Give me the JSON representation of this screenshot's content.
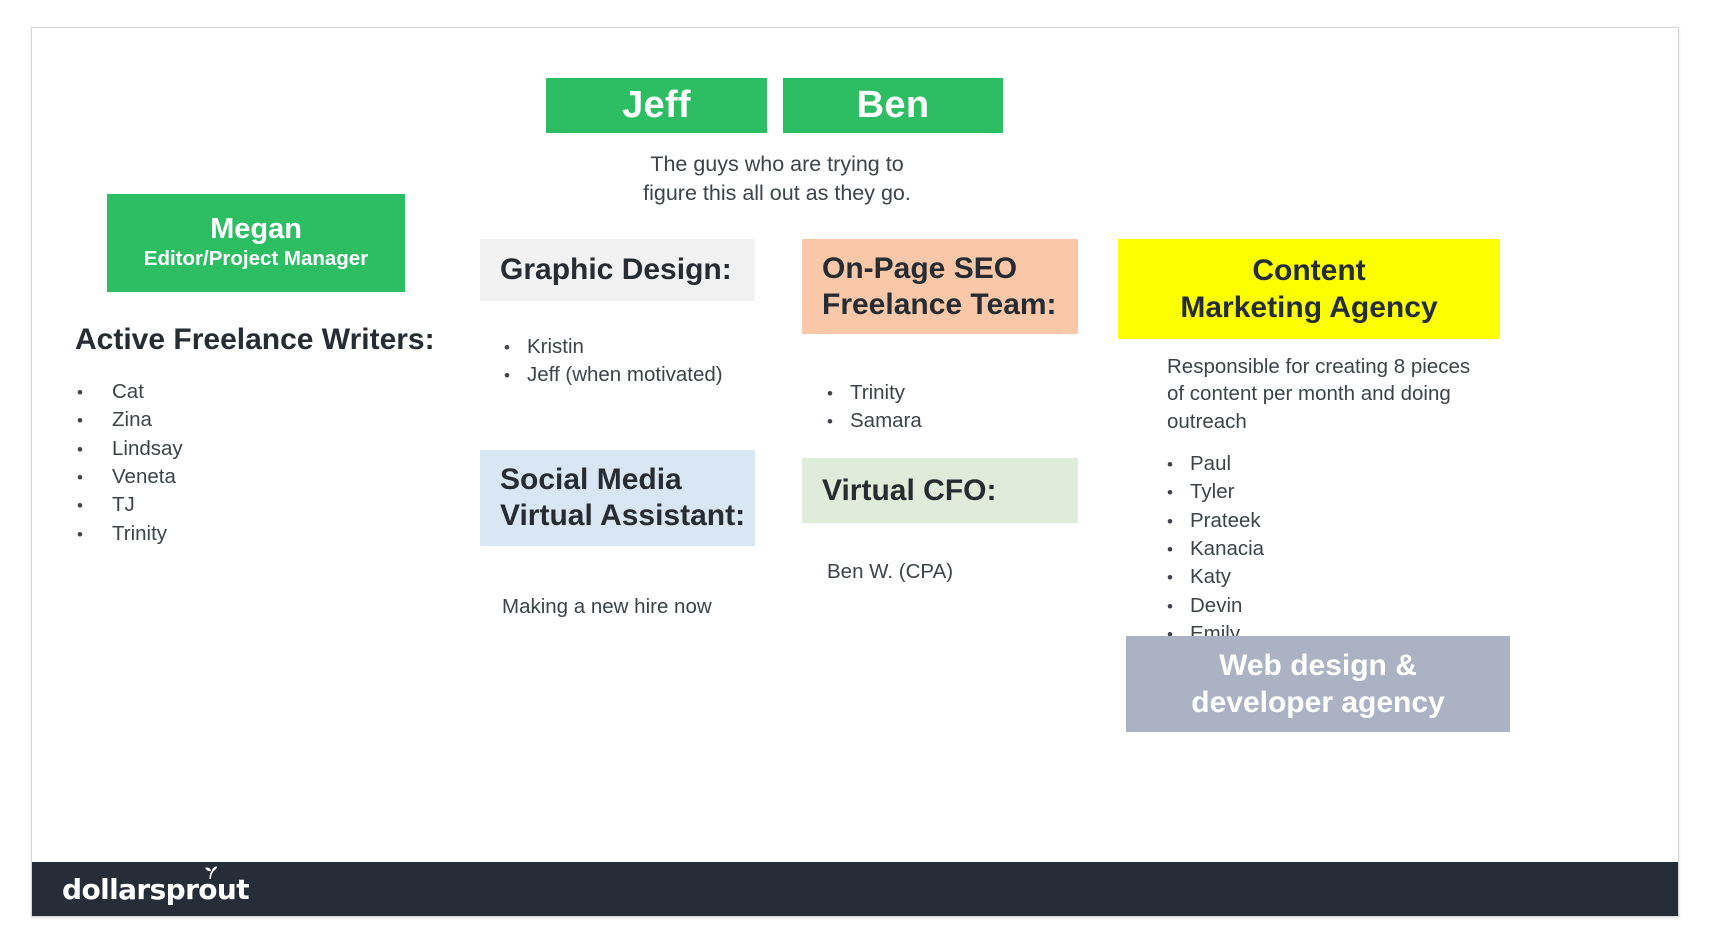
{
  "slide": {
    "leaders": [
      {
        "name": "Jeff"
      },
      {
        "name": "Ben"
      }
    ],
    "leaders_caption": "The guys who are trying to\nfigure this all out as they go.",
    "megan": {
      "name": "Megan",
      "role": "Editor/Project Manager"
    },
    "writers": {
      "heading": "Active Freelance Writers:",
      "names": [
        "Cat",
        "Zina",
        "Lindsay",
        "Veneta",
        "TJ",
        "Trinity"
      ]
    },
    "graphic_design": {
      "heading": "Graphic Design:",
      "names": [
        "Kristin",
        "Jeff (when motivated)"
      ]
    },
    "social_media": {
      "heading": "Social Media\nVirtual Assistant:",
      "note": "Making a new hire now"
    },
    "seo": {
      "heading": "On-Page SEO\nFreelance Team:",
      "names": [
        "Trinity",
        "Samara"
      ]
    },
    "virtual_cfo": {
      "heading": "Virtual CFO:",
      "note": "Ben W. (CPA)"
    },
    "content_agency": {
      "heading": "Content\nMarketing Agency",
      "note": "Responsible for creating 8 pieces\nof content per month and doing\noutreach",
      "names": [
        "Paul",
        "Tyler",
        "Prateek",
        "Kanacia",
        "Katy",
        "Devin",
        "Emily"
      ]
    },
    "web_agency": {
      "heading": "Web design &\ndeveloper agency"
    },
    "footer": {
      "brand": "dollarsprout"
    },
    "colors": {
      "green": "#2dbd63",
      "yellow": "#fbff00",
      "peach": "#f8c8a9",
      "light_blue": "#d9e7f5",
      "light_green": "#dfecd9",
      "light_grey": "#f2f2f2",
      "slate": "#aab2c4",
      "footer": "#262c38"
    }
  }
}
